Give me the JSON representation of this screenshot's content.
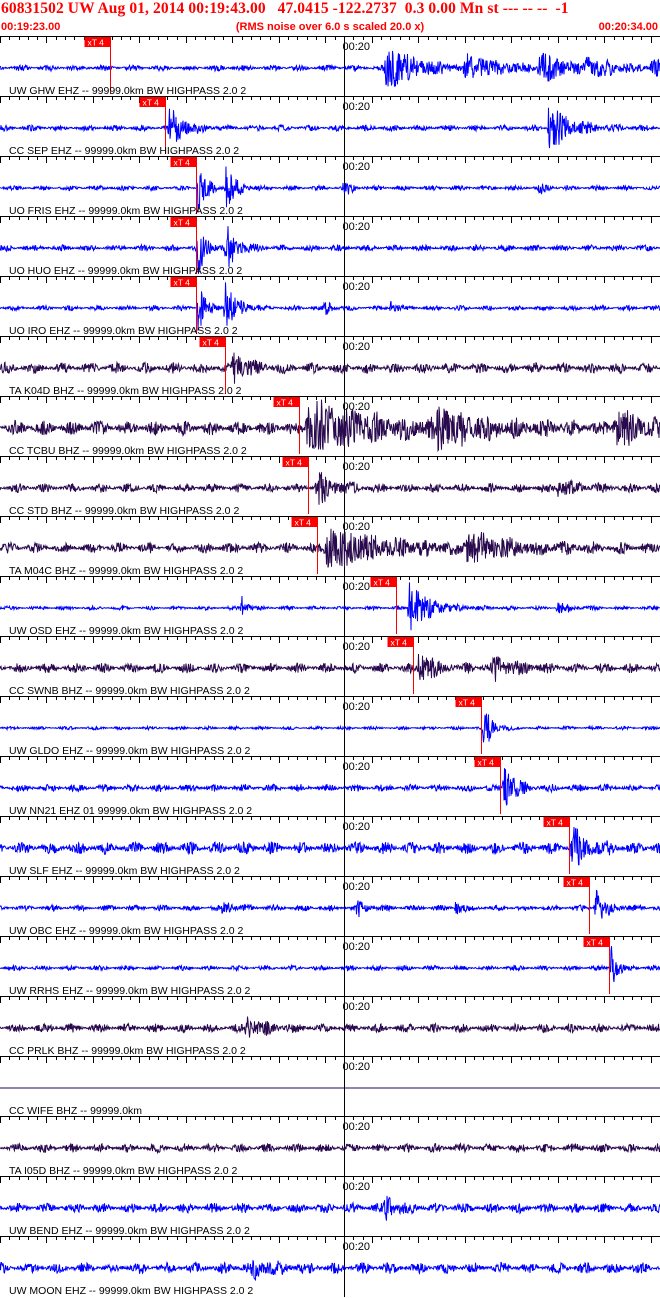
{
  "header": {
    "title": "60831502 UW Aug 01, 2014 00:19:43.00   47.0415 -122.2737  0.3 0.00 Mn st --- -- --  -1",
    "start_time": "00:19:23.00",
    "rms_note": "(RMS noise over 6.0 s scaled 20.0 x)",
    "end_time": "00:20:34.00"
  },
  "colors": {
    "header_text": "#ff0000",
    "trace_blue": "#0000ff",
    "trace_dark": "#2a0a4e",
    "pick_marker": "#ff0000",
    "grid": "#000000"
  },
  "chart_data": {
    "type": "seismogram",
    "time_start": "00:19:23.00",
    "time_end": "00:20:34.00",
    "duration_s": 71,
    "minute_mark": {
      "label": "00:20",
      "t_s": 37
    },
    "pick_label": "xT 4",
    "traces": [
      {
        "label": "UW GHW EHZ -- 99999.0km BW  HIGHPASS  2.0  2",
        "color": "blue",
        "pick_s": 11.8,
        "bursts": [
          {
            "t": 41.5,
            "a": 1.0,
            "d": 3.0
          },
          {
            "t": 50,
            "a": 0.45,
            "d": 4
          },
          {
            "t": 58,
            "a": 0.5,
            "d": 3
          },
          {
            "t": 63,
            "a": 0.35,
            "d": 3
          },
          {
            "t": 70,
            "a": 0.3,
            "d": 2
          }
        ],
        "noise": 0.12,
        "seed": 3
      },
      {
        "label": "CC SEP EHZ -- 99999.0km BW  HIGHPASS  2.0  2",
        "color": "blue",
        "pick_s": 17.8,
        "bursts": [
          {
            "t": 18.2,
            "a": 0.8,
            "d": 1.5
          },
          {
            "t": 59,
            "a": 0.9,
            "d": 2.2
          }
        ],
        "noise": 0.12,
        "seed": 7
      },
      {
        "label": "UO FRIS EHZ -- 99999.0km BW  HIGHPASS  2.0  2",
        "color": "blue",
        "pick_s": 21.1,
        "bursts": [
          {
            "t": 21.3,
            "a": 1.0,
            "d": 0.8
          },
          {
            "t": 24.3,
            "a": 1.0,
            "d": 0.9
          },
          {
            "t": 37,
            "a": 0.5,
            "d": 0.6
          },
          {
            "t": 58,
            "a": 0.35,
            "d": 0.5
          }
        ],
        "noise": 0.1,
        "seed": 11
      },
      {
        "label": "UO HUO EHZ -- 99999.0km BW  HIGHPASS  2.0  2",
        "color": "blue",
        "pick_s": 21.1,
        "bursts": [
          {
            "t": 21.3,
            "a": 1.0,
            "d": 0.8
          },
          {
            "t": 24.3,
            "a": 1.0,
            "d": 1.0
          }
        ],
        "noise": 0.13,
        "seed": 13
      },
      {
        "label": "UO IRO EHZ -- 99999.0km BW  HIGHPASS  2.0  2",
        "color": "blue",
        "pick_s": 21.1,
        "bursts": [
          {
            "t": 21.3,
            "a": 1.0,
            "d": 0.8
          },
          {
            "t": 24.2,
            "a": 1.0,
            "d": 1.2
          },
          {
            "t": 35,
            "a": 0.4,
            "d": 0.5
          },
          {
            "t": 42,
            "a": 0.3,
            "d": 0.5
          }
        ],
        "noise": 0.1,
        "seed": 17
      },
      {
        "label": "TA K04D BHZ -- 99999.0km BW  HIGHPASS  2.0  2",
        "color": "dark",
        "pick_s": 24.2,
        "bursts": [
          {
            "t": 25,
            "a": 0.6,
            "d": 1.5
          }
        ],
        "noise": 0.22,
        "seed": 19
      },
      {
        "label": "CC TCBU BHZ -- 99999.0km BW  HIGHPASS  2.0  2",
        "color": "dark",
        "pick_s": 32.2,
        "bursts": [
          {
            "t": 33,
            "a": 1.0,
            "d": 7
          },
          {
            "t": 47,
            "a": 0.7,
            "d": 4
          },
          {
            "t": 66,
            "a": 0.7,
            "d": 3
          }
        ],
        "noise": 0.3,
        "seed": 23
      },
      {
        "label": "CC STD BHZ -- 99999.0km BW  HIGHPASS  2.0  2",
        "color": "dark",
        "pick_s": 33.1,
        "bursts": [
          {
            "t": 34,
            "a": 0.6,
            "d": 2
          },
          {
            "t": 60,
            "a": 0.3,
            "d": 2
          }
        ],
        "noise": 0.18,
        "seed": 29
      },
      {
        "label": "TA M04C BHZ -- 99999.0km BW  HIGHPASS  2.0  2",
        "color": "dark",
        "pick_s": 34.1,
        "bursts": [
          {
            "t": 35,
            "a": 0.8,
            "d": 6
          },
          {
            "t": 50,
            "a": 0.5,
            "d": 5
          }
        ],
        "noise": 0.22,
        "seed": 31
      },
      {
        "label": "UW OSD EHZ -- 99999.0km BW  HIGHPASS  2.0  2",
        "color": "blue",
        "pick_s": 42.6,
        "bursts": [
          {
            "t": 26,
            "a": 0.5,
            "d": 0.5
          },
          {
            "t": 44,
            "a": 1.0,
            "d": 2.0
          },
          {
            "t": 60,
            "a": 0.3,
            "d": 1
          }
        ],
        "noise": 0.08,
        "seed": 37
      },
      {
        "label": "CC SWNB BHZ -- 99999.0km BW  HIGHPASS  2.0  2",
        "color": "dark",
        "pick_s": 44.4,
        "bursts": [
          {
            "t": 45,
            "a": 0.6,
            "d": 2
          },
          {
            "t": 53,
            "a": 0.4,
            "d": 2
          }
        ],
        "noise": 0.2,
        "seed": 41
      },
      {
        "label": "UW GLDO EHZ -- 99999.0km BW  HIGHPASS  2.0  2",
        "color": "blue",
        "pick_s": 51.7,
        "bursts": [
          {
            "t": 52,
            "a": 1.0,
            "d": 0.8
          }
        ],
        "noise": 0.07,
        "seed": 43
      },
      {
        "label": "UW NN21 EHZ 01 99999.0km BW  HIGHPASS  2.0  2",
        "color": "blue",
        "pick_s": 53.8,
        "bursts": [
          {
            "t": 54.2,
            "a": 0.8,
            "d": 1.2
          }
        ],
        "noise": 0.15,
        "seed": 47
      },
      {
        "label": "UW SLF EHZ -- 99999.0km BW  HIGHPASS  2.0  2",
        "color": "blue",
        "pick_s": 61.2,
        "bursts": [
          {
            "t": 61.5,
            "a": 0.8,
            "d": 1.5
          }
        ],
        "noise": 0.25,
        "seed": 53
      },
      {
        "label": "UW OBC EHZ -- 99999.0km BW  HIGHPASS  2.0  2",
        "color": "blue",
        "pick_s": 63.4,
        "bursts": [
          {
            "t": 64,
            "a": 0.8,
            "d": 1.0
          },
          {
            "t": 24,
            "a": 0.4,
            "d": 0.8
          },
          {
            "t": 38.5,
            "a": 0.5,
            "d": 0.6
          },
          {
            "t": 49,
            "a": 0.35,
            "d": 0.5
          }
        ],
        "noise": 0.12,
        "seed": 59
      },
      {
        "label": "UW RRHS EHZ -- 99999.0km BW  HIGHPASS  2.0  2",
        "color": "blue",
        "pick_s": 65.5,
        "bursts": [
          {
            "t": 65.7,
            "a": 1.0,
            "d": 0.6
          }
        ],
        "noise": 0.1,
        "seed": 61
      },
      {
        "label": "CC PRLK BHZ -- 99999.0km BW  HIGHPASS  2.0  2",
        "color": "dark",
        "pick_s": null,
        "bursts": [
          {
            "t": 26.5,
            "a": 0.5,
            "d": 1.5
          }
        ],
        "noise": 0.18,
        "seed": 67
      },
      {
        "label": "CC WIFE BHZ -- 99999.0km",
        "color": "dark",
        "pick_s": null,
        "bursts": [],
        "noise": 0.0,
        "seed": 71
      },
      {
        "label": "TA I05D BHZ -- 99999.0km BW  HIGHPASS  2.0  2",
        "color": "dark",
        "pick_s": null,
        "bursts": [],
        "noise": 0.18,
        "seed": 73
      },
      {
        "label": "UW BEND EHZ -- 99999.0km BW  HIGHPASS  2.0  2",
        "color": "blue",
        "pick_s": null,
        "bursts": [
          {
            "t": 41.5,
            "a": 0.45,
            "d": 1.2
          }
        ],
        "noise": 0.2,
        "seed": 79
      },
      {
        "label": "UW MOON EHZ -- 99999.0km BW  HIGHPASS  2.0  2",
        "color": "blue",
        "pick_s": null,
        "bursts": [
          {
            "t": 27,
            "a": 0.4,
            "d": 2
          }
        ],
        "noise": 0.22,
        "seed": 83
      }
    ]
  }
}
